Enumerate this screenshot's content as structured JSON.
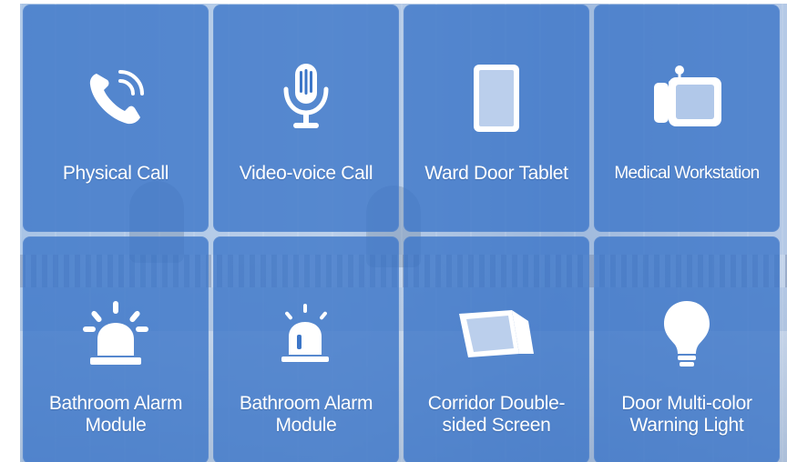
{
  "tiles": [
    {
      "label": "Physical Call",
      "icon": "phone-icon"
    },
    {
      "label": "Video-voice Call",
      "icon": "microphone-icon"
    },
    {
      "label": "Ward Door Tablet",
      "icon": "tablet-icon"
    },
    {
      "label": "Medical Workstation",
      "icon": "workstation-icon"
    },
    {
      "label_line1": "Bathroom Alarm",
      "label_line2": "Module",
      "icon": "alarm-light-icon"
    },
    {
      "label_line1": "Bathroom Alarm",
      "label_line2": "Module",
      "icon": "alarm-beacon-icon"
    },
    {
      "label_line1": "Corridor Double-",
      "label_line2": "sided Screen",
      "icon": "double-sided-screen-icon"
    },
    {
      "label_line1": "Door Multi-color",
      "label_line2": "Warning Light",
      "icon": "light-bulb-icon"
    }
  ],
  "colors": {
    "tile": "#3c76c8",
    "icon": "#ffffff"
  }
}
